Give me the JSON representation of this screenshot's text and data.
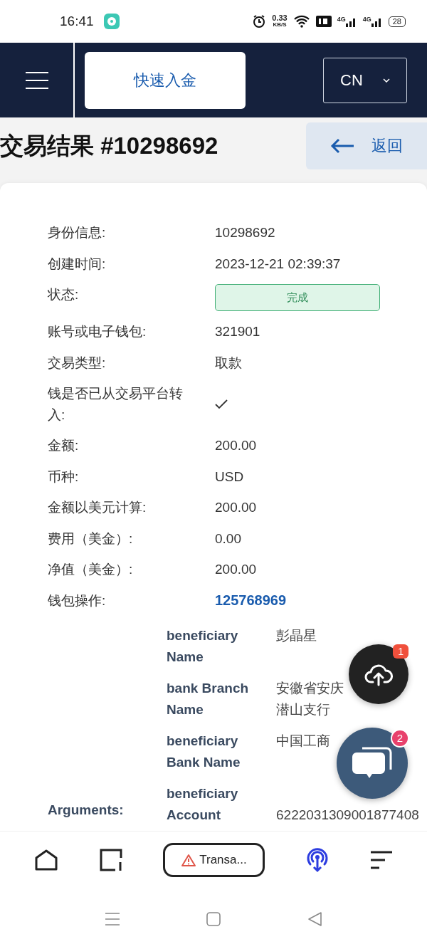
{
  "status_bar": {
    "time": "16:41",
    "speed": "0.33",
    "speed_unit": "KB/S",
    "network_1": "4G",
    "network_2": "4G",
    "battery": "28"
  },
  "header": {
    "quick_deposit": "快速入金",
    "language": "CN"
  },
  "title": "交易结果 #10298692",
  "back_button": "返回",
  "details": [
    {
      "kind": "text",
      "label": "身份信息:",
      "value": "10298692"
    },
    {
      "kind": "text",
      "label": "创建时间:",
      "value": "2023-12-21 02:39:37"
    },
    {
      "kind": "status",
      "label": "状态:",
      "value": "完成"
    },
    {
      "kind": "text",
      "label": "账号或电子钱包:",
      "value": "321901"
    },
    {
      "kind": "text",
      "label": "交易类型:",
      "value": "取款"
    },
    {
      "kind": "check",
      "label": "钱是否已从交易平台转入:",
      "checked": true
    },
    {
      "kind": "text",
      "label": "金额:",
      "value": "200.00"
    },
    {
      "kind": "text",
      "label": "币种:",
      "value": "USD"
    },
    {
      "kind": "text",
      "label": "金额以美元计算:",
      "value": "200.00"
    },
    {
      "kind": "text",
      "label": "费用（美金）:",
      "value": "0.00"
    },
    {
      "kind": "text",
      "label": "净值（美金）:",
      "value": "200.00"
    },
    {
      "kind": "link",
      "label": "钱包操作:",
      "value": "125768969"
    }
  ],
  "arguments": {
    "label": "Arguments:",
    "rows": [
      {
        "label": "beneficiary Name",
        "value": [
          "彭晶星"
        ]
      },
      {
        "label": "bank Branch Name",
        "value": [
          "安徽省安庆",
          "潜山支行"
        ]
      },
      {
        "label": "beneficiary Bank Name",
        "value": [
          "中国工商"
        ]
      },
      {
        "label": "beneficiary Account",
        "value": [
          "6222031309001877408"
        ]
      }
    ]
  },
  "upload_fab": {
    "badge": "1"
  },
  "chat_fab": {
    "badge": "2"
  },
  "browser_bar": {
    "tab_title": "Transa..."
  }
}
